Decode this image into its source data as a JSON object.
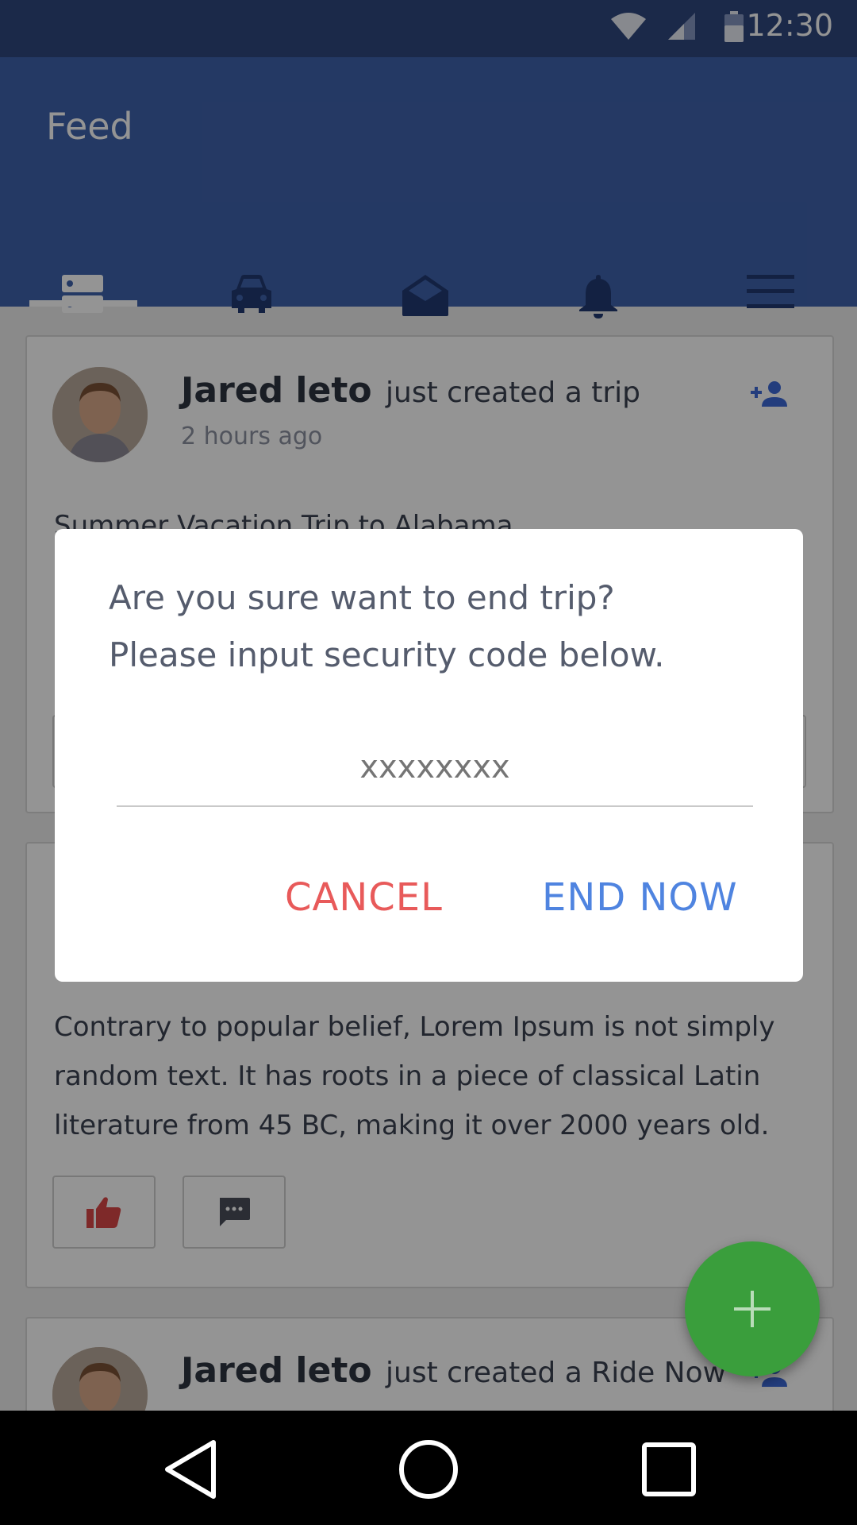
{
  "status_bar": {
    "time": "12:30"
  },
  "app_bar": {
    "title": "Feed",
    "tabs": [
      {
        "icon": "feed-icon"
      },
      {
        "icon": "car-icon"
      },
      {
        "icon": "mail-icon"
      },
      {
        "icon": "bell-icon"
      },
      {
        "icon": "menu-icon"
      }
    ]
  },
  "feed": {
    "post1": {
      "author": "Jared leto",
      "action": "just created a trip",
      "time": "2 hours ago",
      "title": "Summer Vacation Trip to Alabama"
    },
    "post2": {
      "text_line1": "Contrary to popular belief, Lorem Ipsum is not simply",
      "text_line2": "random text. It has roots in a piece of classical Latin",
      "text_line3": "literature from 45 BC, making it over 2000 years old."
    },
    "post3": {
      "author": "Jared leto",
      "action": "just created a Ride Now"
    }
  },
  "dialog": {
    "line1": "Are you sure want to end trip?",
    "line2": "Please input security code below.",
    "input_placeholder": "xxxxxxxx",
    "cancel_label": "CANCEL",
    "confirm_label": "END NOW"
  },
  "colors": {
    "status_bar": "#30477f",
    "app_bar": "#3f63ad",
    "cancel": "#e85a5a",
    "confirm": "#4f84e0",
    "fab": "#3a9e3c",
    "like": "#d94848"
  }
}
